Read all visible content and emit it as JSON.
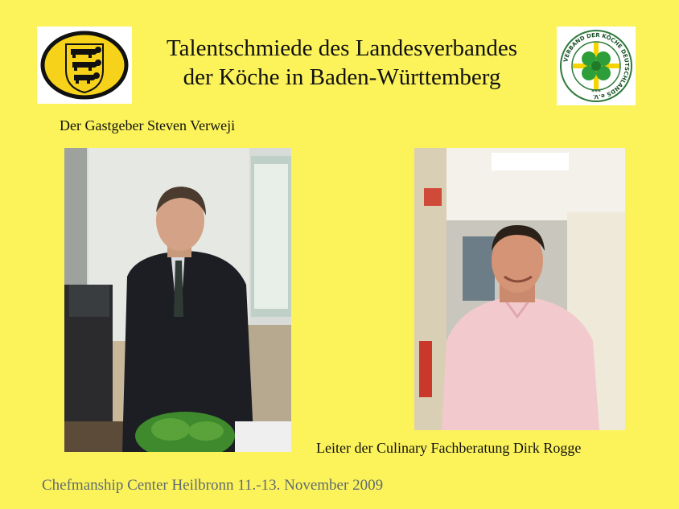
{
  "title": {
    "line1": "Talentschmiede des Landesverbandes",
    "line2": "der Köche in Baden-Württemberg"
  },
  "logos": {
    "left_icon": "baden-wuerttemberg-coat-of-arms",
    "right_icon": "verband-der-koeche-deutschlands-emblem",
    "right_ring_text": "VERBAND DER KÖCHE DEUTSCHLANDS e.V.",
    "right_stars": "***"
  },
  "captions": {
    "host": "Der Gastgeber  Steven Verweji",
    "leader": "Leiter der Culinary Fachberatung Dirk Rogge"
  },
  "footer": "Chefmanship Center Heilbronn 11.-13. November 2009",
  "colors": {
    "background": "#fcf35a",
    "footer_text": "#5f6b70",
    "emblem_green": "#2e9e3a",
    "emblem_yellow": "#f5d400"
  }
}
